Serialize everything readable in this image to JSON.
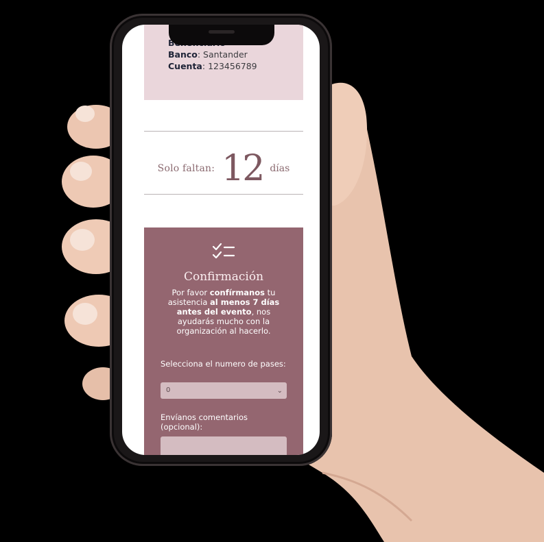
{
  "bank_info": {
    "beneficiary_label": "Beneficiario",
    "beneficiary_value": "",
    "bank_label": "Banco",
    "bank_value": "Santander",
    "account_label": "Cuenta",
    "account_value": "123456789"
  },
  "countdown": {
    "prefix": "Solo faltan:",
    "number": "12",
    "unit": "días"
  },
  "confirmation": {
    "icon": "checklist-icon",
    "title": "Confirmación",
    "intro_1": "Por favor ",
    "intro_bold_1": "confírmanos",
    "intro_2": " tu asistencia ",
    "intro_bold_2": "al menos 7 días antes del evento",
    "intro_3": ", nos ayudarás mucho con la organización al hacerlo.",
    "passes_label": "Selecciona el numero de pases:",
    "passes_value": "0",
    "comments_label": "Envíanos comentarios (opcional):"
  },
  "colors": {
    "bank_card_bg": "#ead6db",
    "confirm_bg": "#946670",
    "countdown_text": "#8b6a70"
  }
}
